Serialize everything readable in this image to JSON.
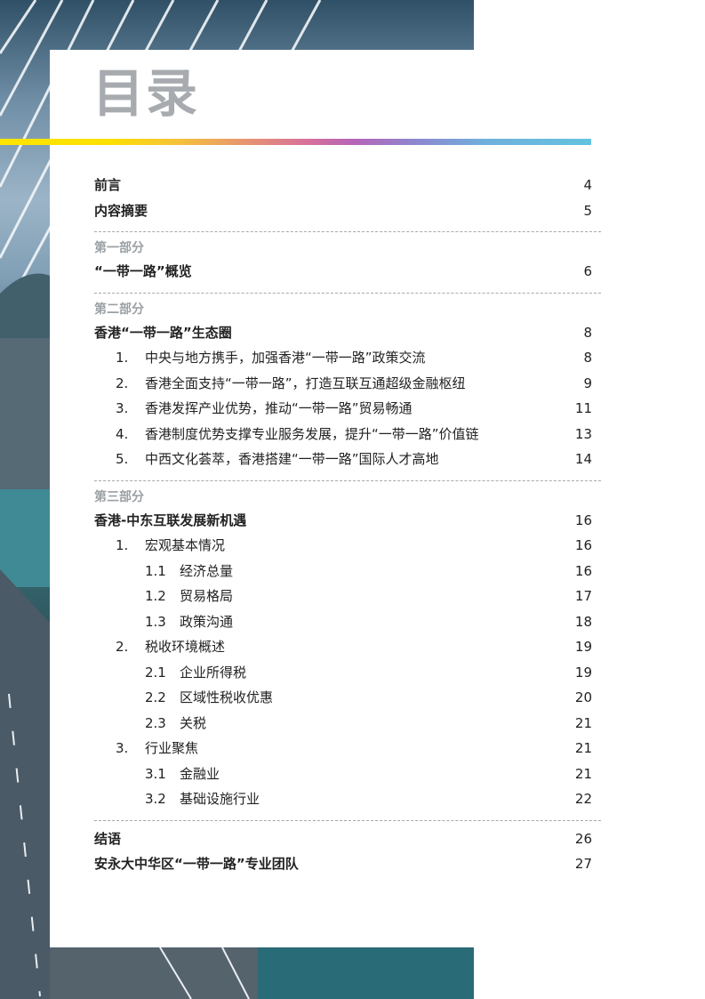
{
  "title": "目录",
  "sections": [
    {
      "type": "row",
      "style": "bold",
      "label": "前言",
      "page": "4"
    },
    {
      "type": "row",
      "style": "bold",
      "label": "内容摘要",
      "page": "5"
    },
    {
      "type": "divider"
    },
    {
      "type": "part",
      "label": "第一部分"
    },
    {
      "type": "row",
      "style": "bold",
      "label": "“一带一路”概览",
      "page": "6"
    },
    {
      "type": "divider"
    },
    {
      "type": "part",
      "label": "第二部分"
    },
    {
      "type": "row",
      "style": "bold",
      "label": "香港“一带一路”生态圈",
      "page": "8"
    },
    {
      "type": "row",
      "level": 1,
      "num": "1.",
      "label": "中央与地方携手，加强香港“一带一路”政策交流",
      "page": "8"
    },
    {
      "type": "row",
      "level": 1,
      "num": "2.",
      "label": "香港全面支持“一带一路”，打造互联互通超级金融枢纽",
      "page": "9"
    },
    {
      "type": "row",
      "level": 1,
      "num": "3.",
      "label": "香港发挥产业优势，推动“一带一路”贸易畅通",
      "page": "11"
    },
    {
      "type": "row",
      "level": 1,
      "num": "4.",
      "label": "香港制度优势支撑专业服务发展，提升“一带一路”价值链",
      "page": "13"
    },
    {
      "type": "row",
      "level": 1,
      "num": "5.",
      "label": "中西文化荟萃，香港搭建“一带一路”国际人才高地",
      "page": "14"
    },
    {
      "type": "divider"
    },
    {
      "type": "part",
      "label": "第三部分"
    },
    {
      "type": "row",
      "style": "bold",
      "label": "香港-中东互联发展新机遇",
      "page": "16"
    },
    {
      "type": "row",
      "level": 1,
      "num": "1.",
      "label": "宏观基本情况",
      "page": "16"
    },
    {
      "type": "row",
      "level": 2,
      "num": "1.1",
      "label": "经济总量",
      "page": "16"
    },
    {
      "type": "row",
      "level": 2,
      "num": "1.2",
      "label": "贸易格局",
      "page": "17"
    },
    {
      "type": "row",
      "level": 2,
      "num": "1.3",
      "label": "政策沟通",
      "page": "18"
    },
    {
      "type": "row",
      "level": 1,
      "num": "2.",
      "label": "税收环境概述",
      "page": "19"
    },
    {
      "type": "row",
      "level": 2,
      "num": "2.1",
      "label": "企业所得税",
      "page": "19"
    },
    {
      "type": "row",
      "level": 2,
      "num": "2.2",
      "label": "区域性税收优惠",
      "page": "20"
    },
    {
      "type": "row",
      "level": 2,
      "num": "2.3",
      "label": "关税",
      "page": "21"
    },
    {
      "type": "row",
      "level": 1,
      "num": "3.",
      "label": "行业聚焦",
      "page": "21"
    },
    {
      "type": "row",
      "level": 2,
      "num": "3.1",
      "label": "金融业",
      "page": "21"
    },
    {
      "type": "row",
      "level": 2,
      "num": "3.2",
      "label": "基础设施行业",
      "page": "22"
    },
    {
      "type": "divider"
    },
    {
      "type": "row",
      "style": "bold",
      "label": "结语",
      "page": "26"
    },
    {
      "type": "row",
      "style": "bold",
      "label": "安永大中华区“一带一路”专业团队",
      "page": "27"
    }
  ]
}
